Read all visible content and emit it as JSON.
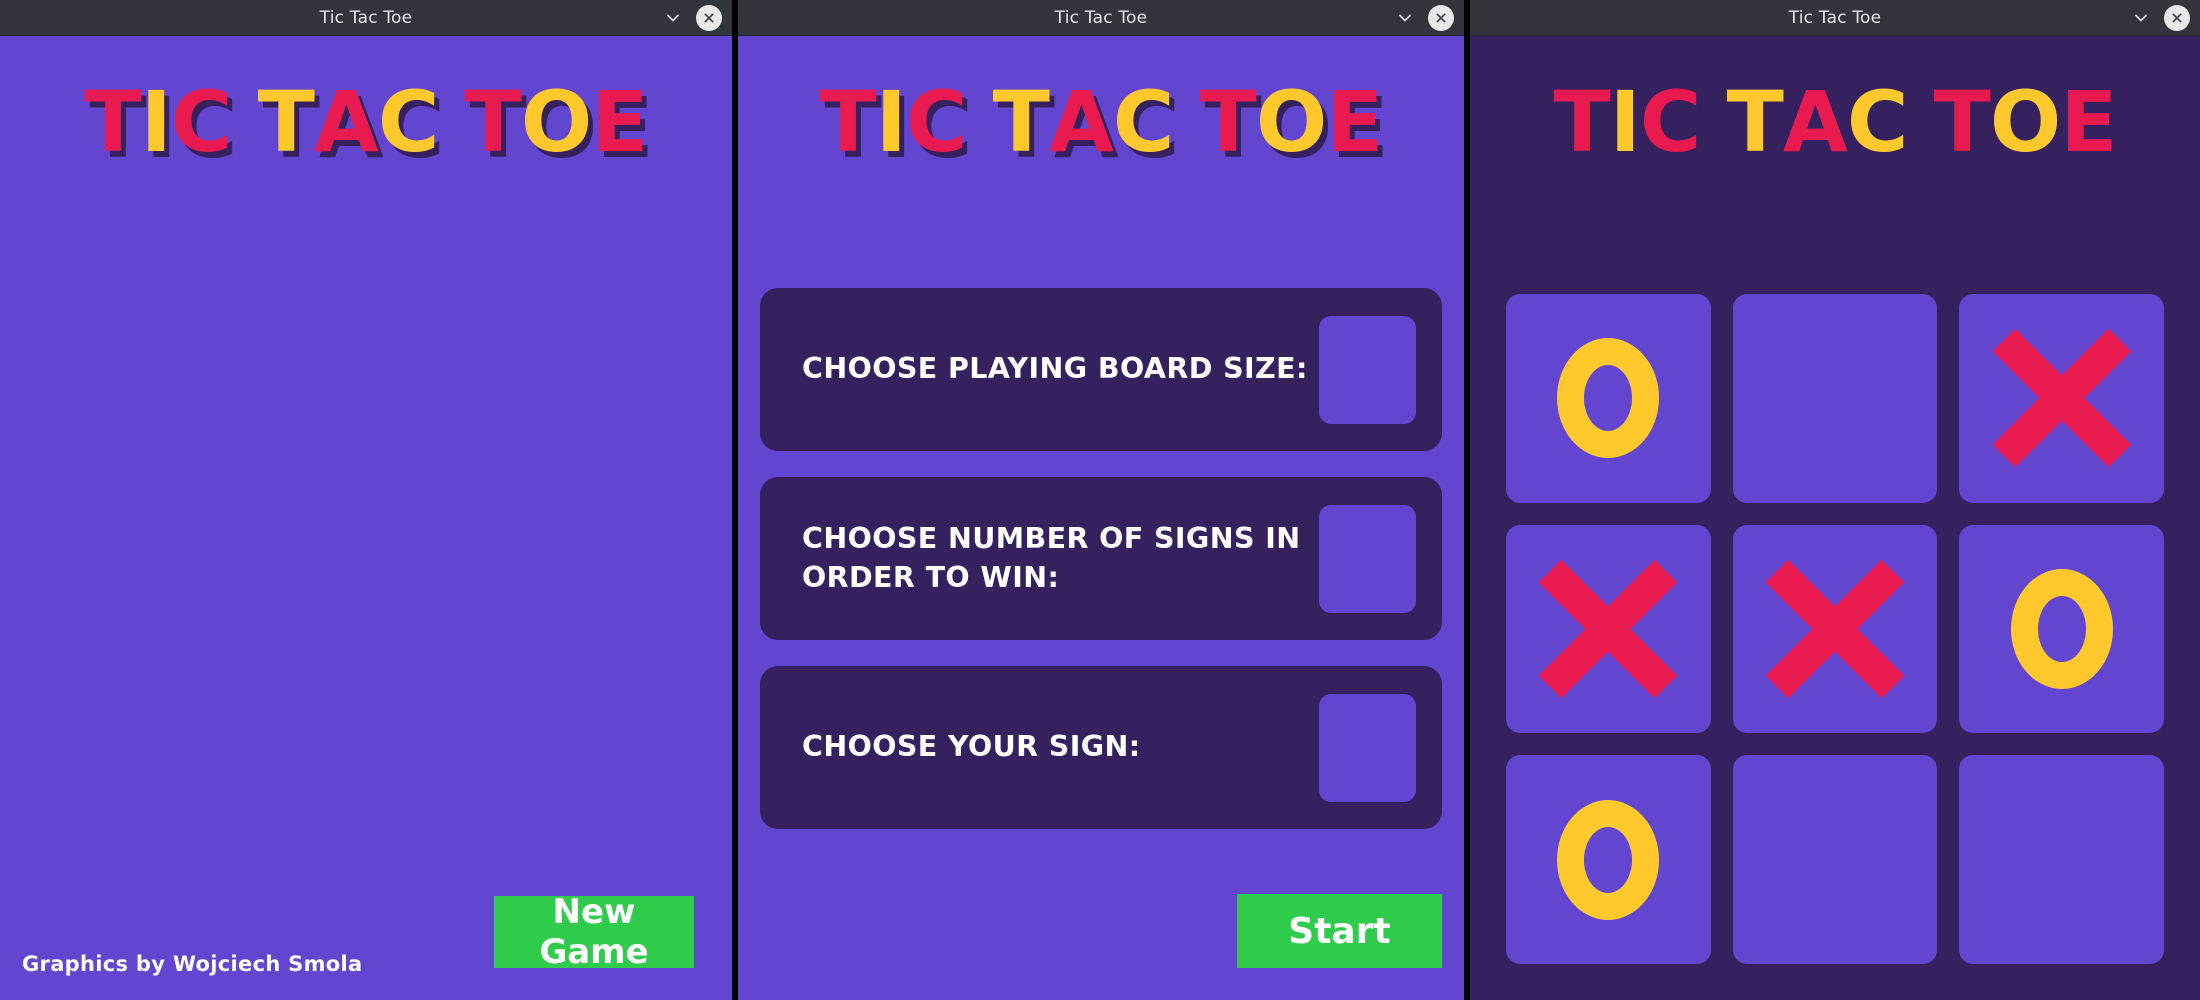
{
  "colors": {
    "purple_bg": "#6246d0",
    "dark_purple": "#35215e",
    "red": "#e81a50",
    "yellow": "#ffc92e",
    "green": "#2ecc4a",
    "titlebar": "#32353b"
  },
  "windows": [
    {
      "title": "Tic Tac Toe"
    },
    {
      "title": "Tic Tac Toe"
    },
    {
      "title": "Tic Tac Toe"
    }
  ],
  "logo": {
    "letters": [
      {
        "ch": "T",
        "color": "#e81a50"
      },
      {
        "ch": "I",
        "color": "#ffc92e"
      },
      {
        "ch": "C",
        "color": "#e81a50"
      },
      {
        "ch": " ",
        "color": ""
      },
      {
        "ch": "T",
        "color": "#ffc92e"
      },
      {
        "ch": "A",
        "color": "#e81a50"
      },
      {
        "ch": "C",
        "color": "#ffc92e"
      },
      {
        "ch": " ",
        "color": ""
      },
      {
        "ch": "T",
        "color": "#e81a50"
      },
      {
        "ch": "O",
        "color": "#ffc92e"
      },
      {
        "ch": "E",
        "color": "#e81a50"
      }
    ],
    "text": "TIC TAC TOE"
  },
  "screen_home": {
    "credit": "Graphics by Wojciech Smola",
    "new_game_label": "New Game"
  },
  "screen_setup": {
    "options": [
      {
        "label": "CHOOSE PLAYING BOARD SIZE:",
        "value": "",
        "placeholder": ""
      },
      {
        "label": "CHOOSE NUMBER OF SIGNS IN ORDER TO WIN:",
        "value": "",
        "placeholder": ""
      },
      {
        "label": "CHOOSE YOUR SIGN:",
        "value": "",
        "placeholder": ""
      }
    ],
    "start_label": "Start"
  },
  "screen_game": {
    "board": [
      [
        "O",
        "",
        "X"
      ],
      [
        "X",
        "X",
        "O"
      ],
      [
        "O",
        "",
        ""
      ]
    ]
  }
}
